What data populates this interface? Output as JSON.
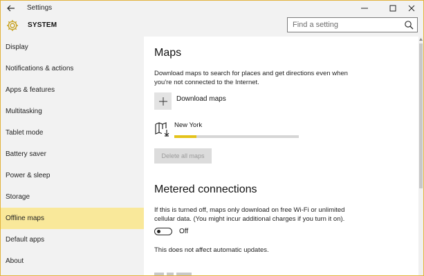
{
  "window": {
    "title": "Settings",
    "accent": "#e2b33c"
  },
  "header": {
    "section": "SYSTEM",
    "search_placeholder": "Find a setting"
  },
  "sidebar": {
    "active_color": "#f9e89a",
    "items": [
      {
        "label": "Display"
      },
      {
        "label": "Notifications & actions"
      },
      {
        "label": "Apps & features"
      },
      {
        "label": "Multitasking"
      },
      {
        "label": "Tablet mode"
      },
      {
        "label": "Battery saver"
      },
      {
        "label": "Power & sleep"
      },
      {
        "label": "Storage"
      },
      {
        "label": "Offline maps",
        "active": true
      },
      {
        "label": "Default apps"
      },
      {
        "label": "About"
      }
    ]
  },
  "maps": {
    "heading": "Maps",
    "description_line1": "Download maps to search for places and get directions even when",
    "description_line2": "you're not connected to the Internet.",
    "download_label": "Download maps",
    "download_icon": "plus-icon",
    "map_icon": "map-download-icon",
    "map_name": "New York",
    "map_progress": 0.18,
    "progress_color": "#e4c31b",
    "delete_all_label": "Delete all maps"
  },
  "metered": {
    "heading": "Metered connections",
    "description_line1": "If this is turned off, maps only download on free Wi-Fi or unlimited",
    "description_line2": "cellular data. (You might incur additional charges if you turn it on).",
    "toggle_state": "Off",
    "note": "This does not affect automatic updates."
  }
}
